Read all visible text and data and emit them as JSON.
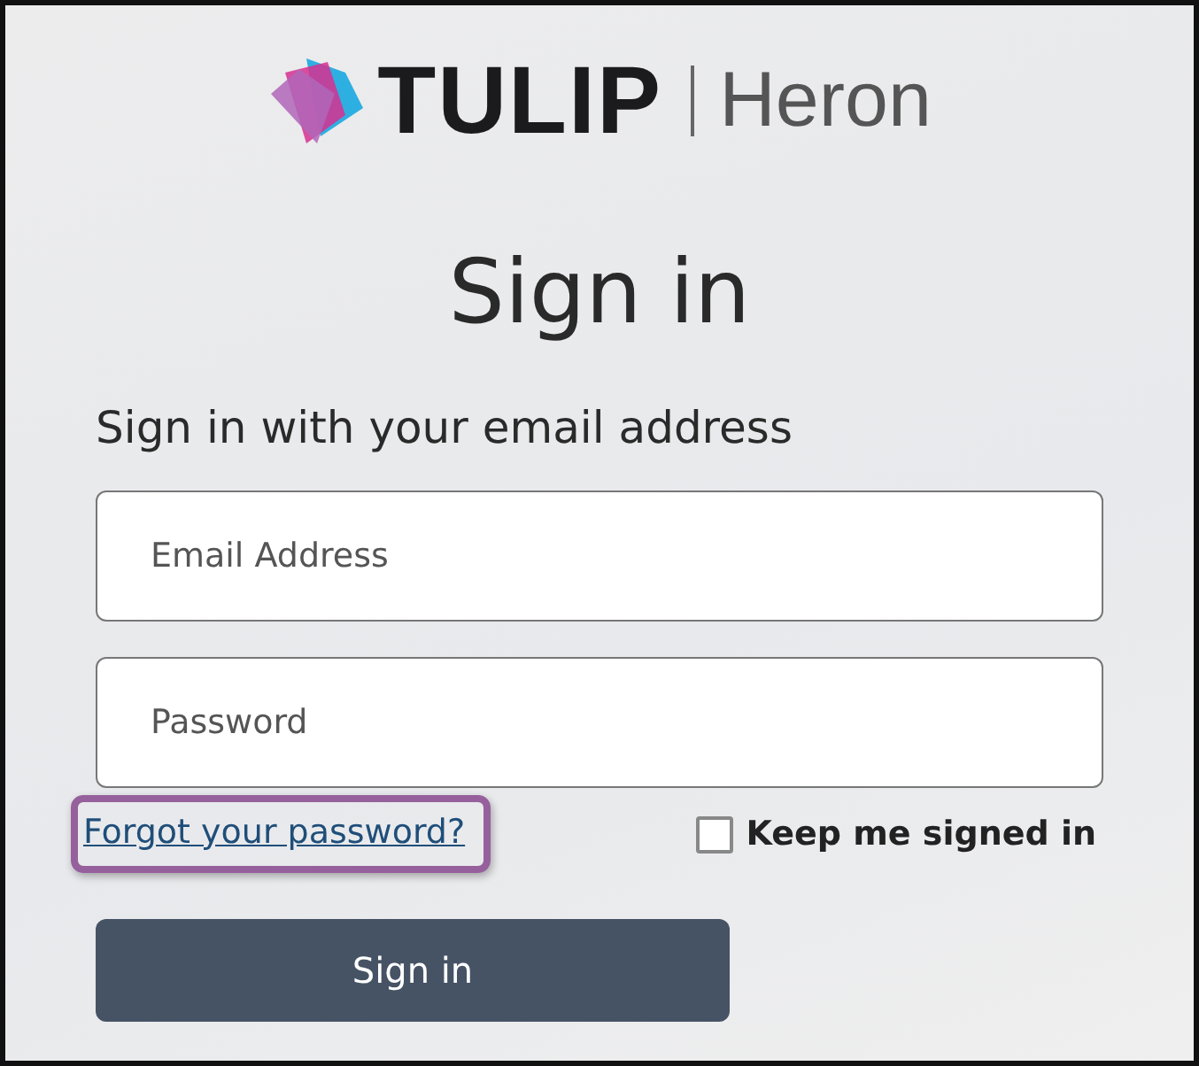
{
  "logo": {
    "brand": "TULIP",
    "product": "Heron"
  },
  "title": "Sign in",
  "subtitle": "Sign in with your email address",
  "fields": [
    {
      "placeholder": "Email Address"
    },
    {
      "placeholder": "Password"
    }
  ],
  "forgot_link": {
    "label": "Forgot your password?",
    "highlighted": true
  },
  "keep_signed_in": {
    "label": "Keep me signed in",
    "checked": false
  },
  "submit_button": "Sign in"
}
